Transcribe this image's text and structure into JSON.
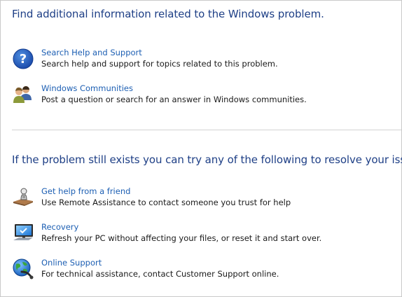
{
  "find_section": {
    "heading": "Find additional information related to the Windows problem.",
    "items": [
      {
        "icon": "help-question-icon",
        "link": "Search Help and Support",
        "description": "Search help and support for topics related to this problem."
      },
      {
        "icon": "people-community-icon",
        "link": "Windows Communities",
        "description": "Post a question or search for an answer in Windows communities."
      }
    ]
  },
  "resolve_section": {
    "heading": "If the problem still exists you can try any of the following to resolve your issue.",
    "items": [
      {
        "icon": "remote-assistance-icon",
        "link": "Get help from a friend",
        "description": "Use Remote Assistance to contact someone you trust for help"
      },
      {
        "icon": "recovery-monitor-icon",
        "link": "Recovery",
        "description": "Refresh your PC without affecting your files, or reset it and start over."
      },
      {
        "icon": "globe-support-icon",
        "link": "Online Support",
        "description": "For technical assistance, contact Customer Support online."
      }
    ]
  },
  "colors": {
    "heading": "#1e3f86",
    "link": "#1d5fb3",
    "divider": "#d3d3d3"
  }
}
